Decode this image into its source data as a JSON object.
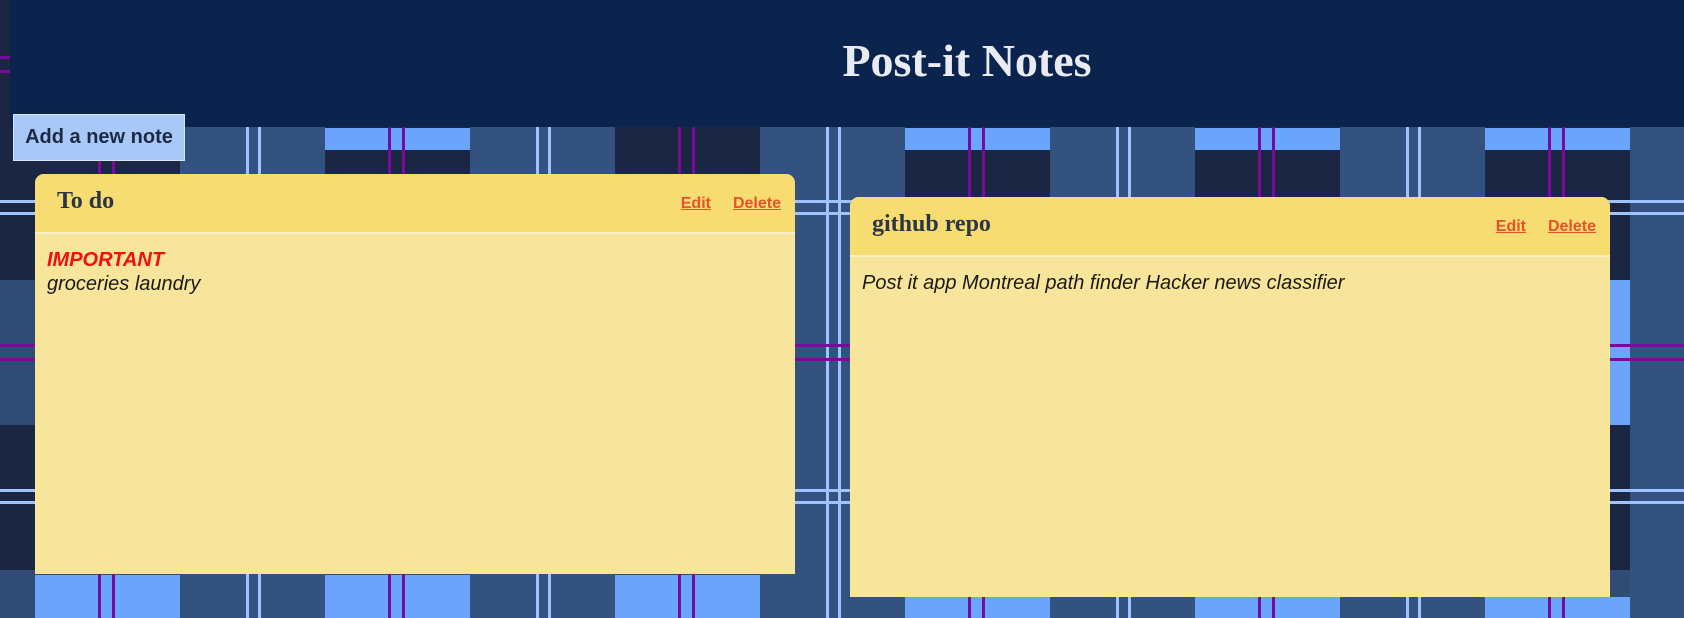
{
  "page": {
    "title": "Post-it Notes",
    "add_button_label": "Add a new note"
  },
  "notes": [
    {
      "title": "To do",
      "edit_label": "Edit",
      "delete_label": "Delete",
      "important_label": "IMPORTANT",
      "body": "groceries laundry"
    },
    {
      "title": "github repo",
      "edit_label": "Edit",
      "delete_label": "Delete",
      "body": "Post it app Montreal path finder Hacker news classifier"
    }
  ],
  "colors": {
    "header_bg": "#0b244d",
    "note_bg": "#f8e59c",
    "note_header_bg": "#f7dc72",
    "link": "#e8512a",
    "important": "#f20f0f",
    "button_bg": "#a8c8f8"
  }
}
